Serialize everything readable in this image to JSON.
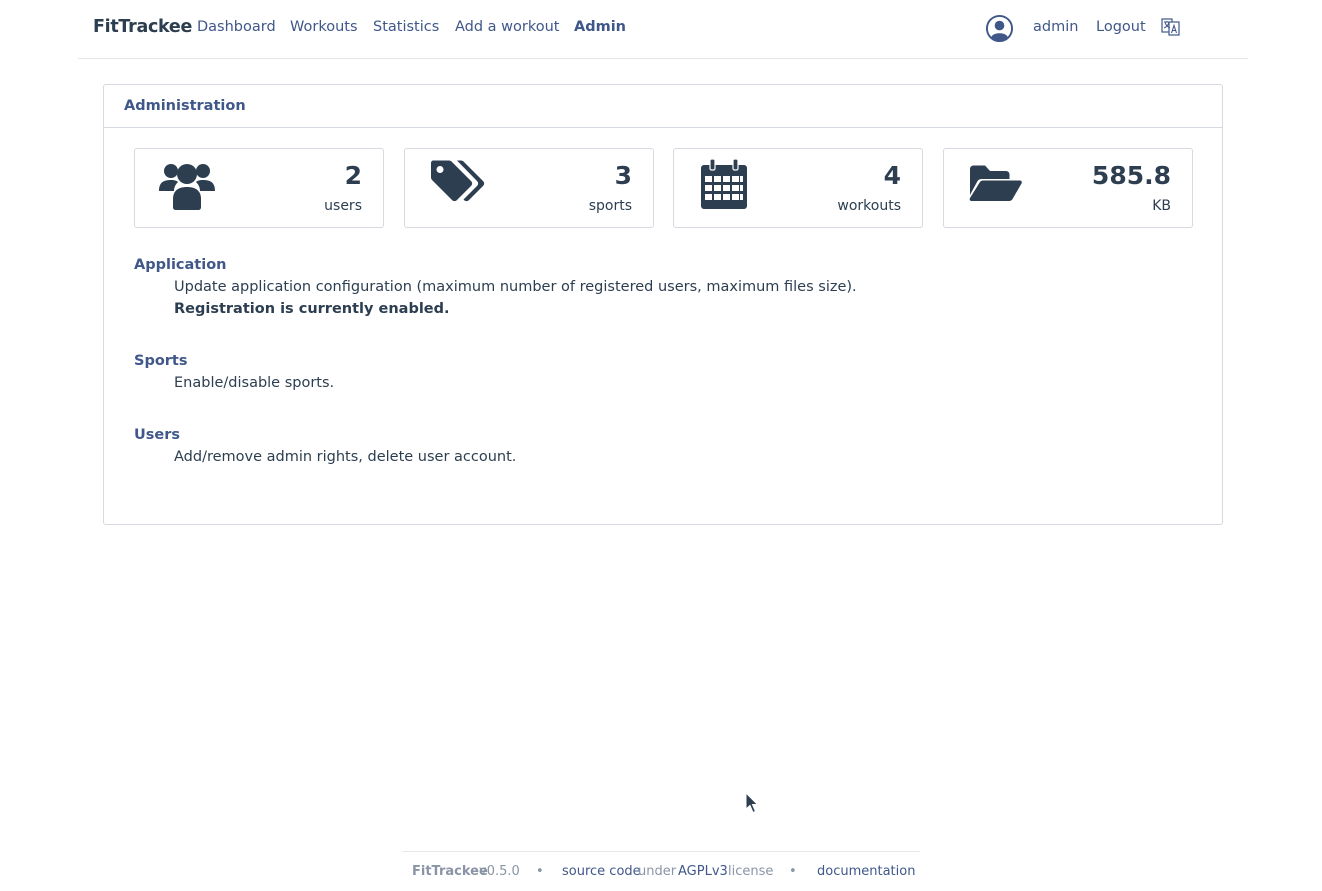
{
  "navbar": {
    "brand": "FitTrackee",
    "items": [
      {
        "label": "Dashboard"
      },
      {
        "label": "Workouts"
      },
      {
        "label": "Statistics"
      },
      {
        "label": "Add a workout"
      },
      {
        "label": "Admin",
        "active": true
      }
    ],
    "user_icon": "user-circle-icon",
    "username": "admin",
    "logout": "Logout",
    "language_icon": "language-icon"
  },
  "admin": {
    "title": "Administration",
    "stats": [
      {
        "icon": "users-icon",
        "value": "2",
        "label": "users"
      },
      {
        "icon": "tags-icon",
        "value": "3",
        "label": "sports"
      },
      {
        "icon": "calendar-icon",
        "value": "4",
        "label": "workouts"
      },
      {
        "icon": "folder-open-icon",
        "value": "585.8",
        "label": "KB"
      }
    ],
    "sections": {
      "application": {
        "title": "Application",
        "description": "Update application configuration (maximum number of registered users, maximum files size).",
        "status": "Registration is currently enabled."
      },
      "sports": {
        "title": "Sports",
        "description": "Enable/disable sports."
      },
      "users": {
        "title": "Users",
        "description": "Add/remove admin rights, delete user account."
      }
    }
  },
  "footer": {
    "app_name": "FitTrackee",
    "version": "v0.5.0",
    "separator": "•",
    "source_code": "source code",
    "under": "under",
    "license_name": "AGPLv3",
    "license": "license",
    "documentation": "documentation"
  },
  "colors": {
    "primary": "#40578a",
    "text": "#2c3e50",
    "border": "#d5d9e0",
    "muted": "#8a94a6"
  }
}
